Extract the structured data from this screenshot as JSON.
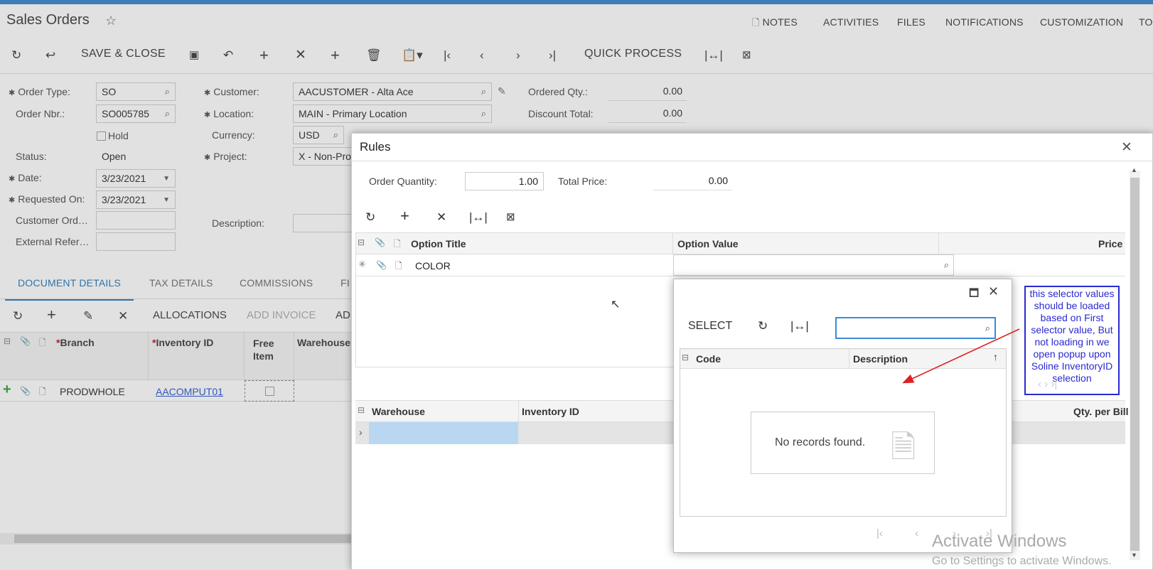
{
  "page": {
    "title": "Sales Orders",
    "top_links": [
      "NOTES",
      "ACTIVITIES",
      "FILES",
      "NOTIFICATIONS",
      "CUSTOMIZATION",
      "TO"
    ]
  },
  "toolbar": {
    "save_close": "SAVE & CLOSE",
    "quick_process": "QUICK PROCESS"
  },
  "form": {
    "order_type_label": "Order Type:",
    "order_type": "SO",
    "order_nbr_label": "Order Nbr.:",
    "order_nbr": "SO005785",
    "hold_label": "Hold",
    "status_label": "Status:",
    "status": "Open",
    "date_label": "Date:",
    "date": "3/23/2021",
    "requested_on_label": "Requested On:",
    "requested_on": "3/23/2021",
    "customer_ord_label": "Customer Ord…",
    "external_ref_label": "External Refer…",
    "customer_label": "Customer:",
    "customer": "AACUSTOMER - Alta Ace",
    "location_label": "Location:",
    "location": "MAIN - Primary Location",
    "currency_label": "Currency:",
    "currency": "USD",
    "project_label": "Project:",
    "project": "X - Non-Pro",
    "description_label": "Description:",
    "ordered_qty_label": "Ordered Qty.:",
    "ordered_qty": "0.00",
    "discount_total_label": "Discount Total:",
    "discount_total": "0.00"
  },
  "tabs": [
    "DOCUMENT DETAILS",
    "TAX DETAILS",
    "COMMISSIONS",
    "FI"
  ],
  "details_toolbar": {
    "allocations": "ALLOCATIONS",
    "add_invoice": "ADD INVOICE",
    "ad": "AD"
  },
  "details_grid": {
    "headers": {
      "branch": "Branch",
      "inventory_id": "Inventory ID",
      "free_item": "Free Item",
      "warehouse": "Warehouse"
    },
    "row": {
      "branch": "PRODWHOLE",
      "inventory_id": "AACOMPUT01"
    }
  },
  "dialog": {
    "title": "Rules",
    "order_qty_label": "Order Quantity:",
    "order_qty": "1.00",
    "total_price_label": "Total Price:",
    "total_price": "0.00",
    "grid_headers": {
      "option_title": "Option Title",
      "option_value": "Option Value",
      "price": "Price"
    },
    "grid_row": {
      "option_title": "COLOR"
    },
    "lower_headers": {
      "warehouse": "Warehouse",
      "inventory_id": "Inventory ID",
      "qty_per_bill": "Qty. per Bill"
    }
  },
  "selector": {
    "select_label": "SELECT",
    "search_value": "",
    "headers": {
      "code": "Code",
      "description": "Description"
    },
    "empty_text": "No records found."
  },
  "annotation": {
    "text": "this selector values should be loaded based on First selector value, But not loading in we open popup upon Soline InventoryID selection",
    "color": "#2a2ad0",
    "arrow_color": "#e02020"
  },
  "watermark": {
    "line1": "Activate Windows",
    "line2": "Go to Settings to activate Windows."
  },
  "colors": {
    "accent": "#1e72b8",
    "topbar": "#2f7fc8"
  }
}
